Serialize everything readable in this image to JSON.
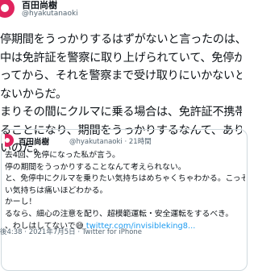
{
  "author": {
    "name": "百田尚樹",
    "handle": "@hyakutanaoki"
  },
  "tweet": {
    "lines": [
      "停期間をうっかりするはずがないと言ったのは、免",
      "中は免許証を警察に取り上げられていて、免停が終",
      "ってから、それを警察まで受け取りにいかないとい",
      "ないからだ。",
      "まりその間にクルマに乗る場合は、免許証不携帯で",
      "ることになり、期間をうっかりするなんて、あり得",
      "いのだ。"
    ]
  },
  "quoted": {
    "name": "百田尚樹",
    "meta": "@hyakutanaoki · 21時間",
    "lines": [
      "去4回、免停になった私が言う。",
      "停の期間をうっかりすることなんて考えられない。",
      "と、免停中にクルマを乗りたい気持ちはめちゃくちゃわかる。こっそりと乗",
      "い気持ちは痛いほどわかる。",
      "かーし！",
      "るなら、細心の注意を配り、超模範運転・安全運転をするべき。",
      "、わしはしてないで😅 twitter.com/invisibleking8..."
    ],
    "link_text": "twitter.com/invisibleking8..."
  },
  "footer": {
    "meta": "後4:38 · 2021年7月5日 · Twitter for iPhone"
  }
}
